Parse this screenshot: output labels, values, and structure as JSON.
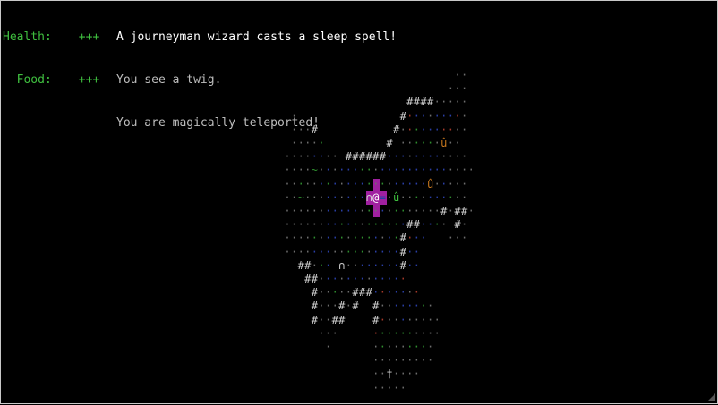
{
  "status": {
    "health_label": "Health:",
    "health_value": "+++",
    "food_label": "Food:",
    "food_value": "+++"
  },
  "messages": [
    "A journeyman wizard casts a sleep spell!",
    "You see a twig.",
    "You are magically teleported!"
  ],
  "colors": {
    "status_green": "#3fbf3f",
    "message_latest": "#ffffff",
    "message_old": "#bdbdbd",
    "player_highlight": "#a020a0",
    "wall": "#cfcfcf",
    "floor_grey": "#6e6e6e",
    "floor_blue": "#2a3fa8",
    "floor_green": "#2f8f2f",
    "floor_red": "#a83a2a",
    "item_orange": "#c8781e",
    "item_green": "#3fbf3f"
  },
  "map": {
    "player_glyph": "@",
    "wall_glyph": "#",
    "floor_glyph": "·",
    "door_glyph": "∩",
    "item_glyph": "û",
    "grass_glyph": "~",
    "dagger_glyph": "†"
  }
}
